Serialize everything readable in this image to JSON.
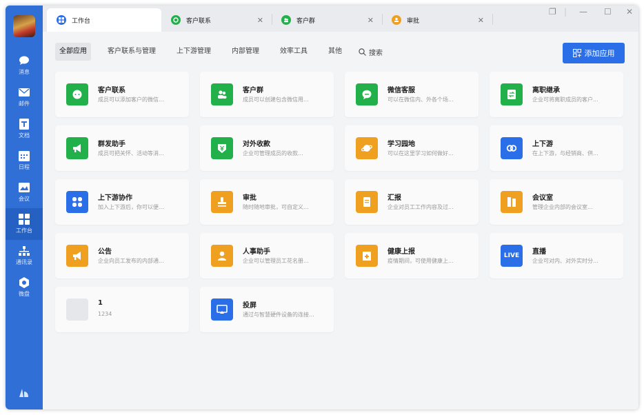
{
  "sidebar": {
    "items": [
      {
        "label": "消息",
        "icon": "chat-bubble-icon"
      },
      {
        "label": "邮件",
        "icon": "mail-icon"
      },
      {
        "label": "文档",
        "icon": "document-icon"
      },
      {
        "label": "日程",
        "icon": "calendar-icon"
      },
      {
        "label": "会议",
        "icon": "meeting-icon"
      },
      {
        "label": "工作台",
        "icon": "workbench-grid-icon",
        "active": true
      },
      {
        "label": "通讯录",
        "icon": "contacts-tree-icon"
      },
      {
        "label": "微盘",
        "icon": "cloud-disk-icon"
      }
    ],
    "bottom_icon": "app-logo-icon"
  },
  "tabs": [
    {
      "title": "工作台",
      "active": true,
      "color": "#2a6ee8"
    },
    {
      "title": "客户联系",
      "active": false,
      "color": "#22b04a"
    },
    {
      "title": "客户群",
      "active": false,
      "color": "#22b04a"
    },
    {
      "title": "审批",
      "active": false,
      "color": "#f0a020"
    }
  ],
  "window_controls": {
    "restore": "❐",
    "minimize": "—",
    "maximize": "☐",
    "close": "✕"
  },
  "filters": [
    "全部应用",
    "客户联系与管理",
    "上下游管理",
    "内部管理",
    "效率工具",
    "其他"
  ],
  "search_label": "搜索",
  "add_button_label": "添加应用",
  "apps": [
    {
      "title": "客户联系",
      "desc": "成员可以添加客户的微信...",
      "color": "#22b04a",
      "glyph": "chat"
    },
    {
      "title": "客户群",
      "desc": "成员可以创建包含微信用...",
      "color": "#22b04a",
      "glyph": "group"
    },
    {
      "title": "微信客服",
      "desc": "可以在微信内、外各个场...",
      "color": "#22b04a",
      "glyph": "service"
    },
    {
      "title": "离职继承",
      "desc": "企业可将离职成员的客户...",
      "color": "#22b04a",
      "glyph": "transfer"
    },
    {
      "title": "群发助手",
      "desc": "成员可把关怀、活动等消...",
      "color": "#22b04a",
      "glyph": "megaphone"
    },
    {
      "title": "对外收款",
      "desc": "企业可管理成员的收款...",
      "color": "#22b04a",
      "glyph": "payment"
    },
    {
      "title": "学习园地",
      "desc": "可以在这里学习如何做好...",
      "color": "#f0a020",
      "glyph": "planet"
    },
    {
      "title": "上下游",
      "desc": "在上下游，与经销商、供...",
      "color": "#2a6ee8",
      "glyph": "link"
    },
    {
      "title": "上下游协作",
      "desc": "加入上下游后，你可以便...",
      "color": "#2a6ee8",
      "glyph": "grid"
    },
    {
      "title": "审批",
      "desc": "随时随地审批，可自定义...",
      "color": "#f0a020",
      "glyph": "stamp"
    },
    {
      "title": "汇报",
      "desc": "企业对员工工作内容及过...",
      "color": "#f0a020",
      "glyph": "report"
    },
    {
      "title": "会议室",
      "desc": "管理企业内部的会议室...",
      "color": "#f0a020",
      "glyph": "door"
    },
    {
      "title": "公告",
      "desc": "企业向员工发布的内部通...",
      "color": "#f0a020",
      "glyph": "megaphone"
    },
    {
      "title": "人事助手",
      "desc": "企业可以管理员工花名册...",
      "color": "#f0a020",
      "glyph": "person"
    },
    {
      "title": "健康上报",
      "desc": "疫情期间，可使用健康上...",
      "color": "#f0a020",
      "glyph": "health"
    },
    {
      "title": "直播",
      "desc": "企业可对内、对外实时分...",
      "color": "#2a6ee8",
      "glyph": "live",
      "icon_text": "LIVE"
    },
    {
      "title": "1",
      "desc": "1234",
      "color": "#e6e7ea",
      "glyph": "blank"
    },
    {
      "title": "投屏",
      "desc": "通过与智慧硬件设备的连接...",
      "color": "#2a6ee8",
      "glyph": "screen"
    }
  ]
}
